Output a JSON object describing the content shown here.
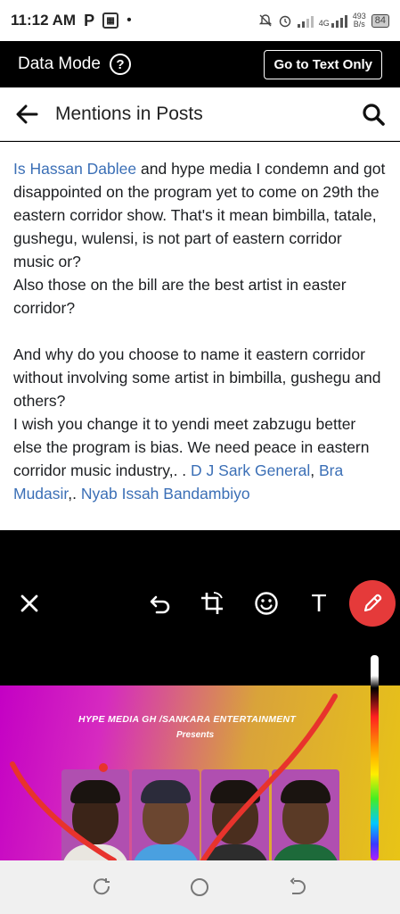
{
  "status_bar": {
    "time": "11:12 AM",
    "network_type": "4G",
    "speed_value": "493",
    "speed_unit": "B/s",
    "battery": "84"
  },
  "data_bar": {
    "label": "Data Mode",
    "help_glyph": "?",
    "text_only_button": "Go to Text Only"
  },
  "header": {
    "title": "Mentions in Posts"
  },
  "post": {
    "mention_1": "Is Hassan Dablee",
    "line_1": " and hype media I condemn and got disappointed on the program yet to come on 29th the  eastern corridor show. That's it mean bimbilla, tatale, gushegu, wulensi,  is not part of eastern corridor music or?",
    "line_2": "Also those on the bill are the best artist in easter corridor?",
    "line_3": "And why do you choose to name  it eastern corridor without involving some artist in bimbilla, gushegu and others?",
    "line_4": "I wish you change it to yendi meet zabzugu better else the program is bias. We need peace in eastern corridor music industry,.   . ",
    "mention_2": "D J Sark General",
    "sep_1": ", ",
    "mention_3": "Bra Mudasir",
    "sep_2": ",. ",
    "mention_4": "Nyab Issah Bandambiyo"
  },
  "editor": {
    "text_tool": "T",
    "poster_title": "HYPE MEDIA GH /SANKARA ENTERTAINMENT",
    "poster_subtitle": "Presents"
  },
  "icons": {
    "back": "arrow-left-icon",
    "search": "search-icon",
    "close": "close-icon",
    "undo": "undo-icon",
    "crop": "crop-rotate-icon",
    "emoji": "emoji-icon",
    "pencil": "pencil-icon",
    "recents": "recents-icon",
    "home": "home-icon",
    "nav_back": "nav-back-icon"
  },
  "colors": {
    "mention": "#3b6fb6",
    "pencil_active": "#e53a3a",
    "drawing_stroke": "#e8332c"
  }
}
